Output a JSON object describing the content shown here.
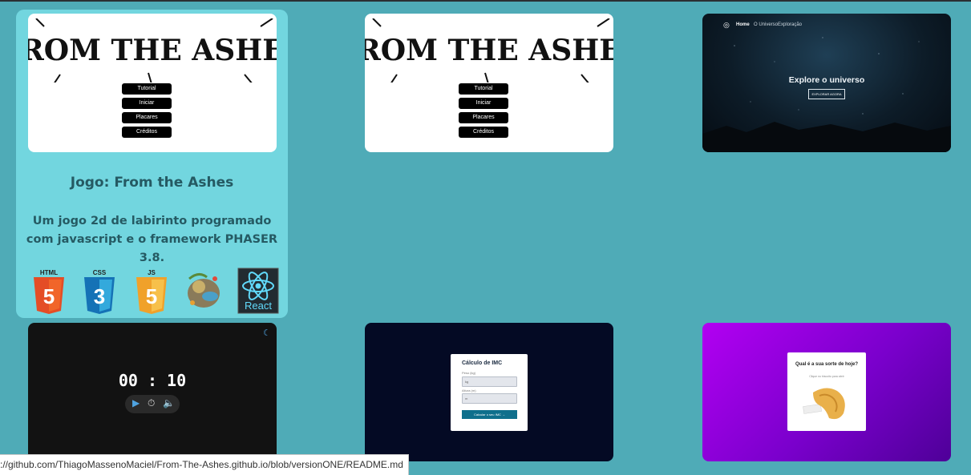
{
  "projects": {
    "game": {
      "title": "Jogo: From the Ashes",
      "description": "Um jogo 2d de labirinto programado com javascript e o framework PHASER 3.8.",
      "logo_text": "FROM THE ASHES",
      "menu": [
        "Tutorial",
        "Iniciar",
        "Placares",
        "Créditos"
      ],
      "tech": [
        {
          "name": "HTML",
          "icon": "html5-icon",
          "color": "#e44d26"
        },
        {
          "name": "CSS",
          "icon": "css3-icon",
          "color": "#1572b6"
        },
        {
          "name": "JS",
          "icon": "js-icon",
          "color": "#f0a12a"
        },
        {
          "name": "Phaser",
          "icon": "phaser-icon",
          "color": "#8a7b5a"
        },
        {
          "name": "React",
          "icon": "react-icon",
          "color": "#61dafb"
        }
      ]
    },
    "universe": {
      "nav": [
        "Home",
        "O Universo",
        "Exploração"
      ],
      "heading": "Explore o universo",
      "button": "EXPLORAR AGORA"
    },
    "timer": {
      "time": "00 : 10"
    },
    "imc": {
      "title": "Cálculo de IMC",
      "weight_label": "Peso (kg)",
      "weight_placeholder": "kg",
      "height_label": "Altura (m)",
      "height_placeholder": "m",
      "button": "Calcular o seu IMC →"
    },
    "fortune": {
      "title": "Qual é a sua sorte de hoje?",
      "subtitle": "Clique no biscoito para abrir"
    }
  },
  "status_url": "://github.com/ThiagoMassenoMaciel/From-The-Ashes.github.io/blob/versionONE/README.md"
}
